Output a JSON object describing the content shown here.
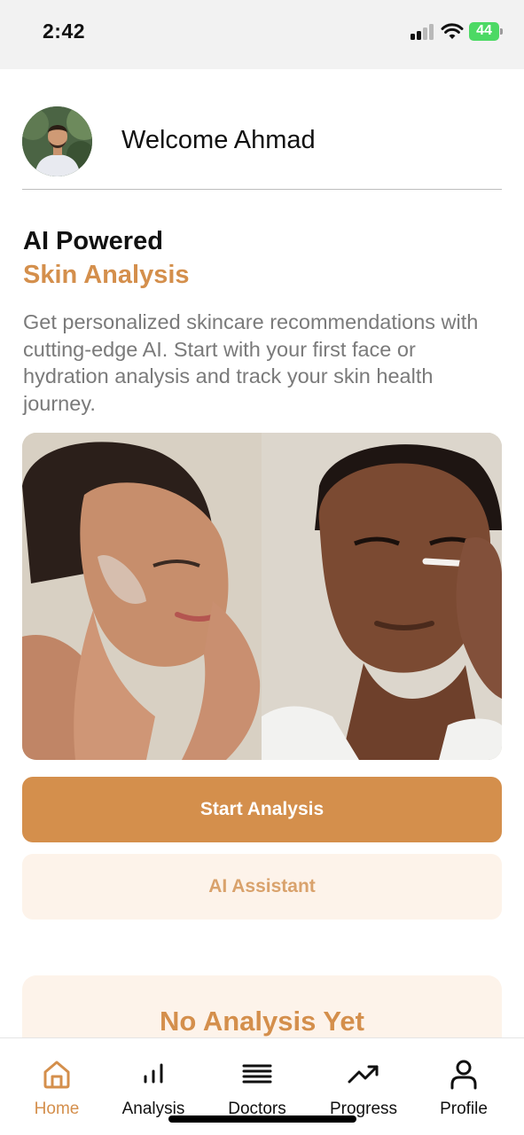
{
  "status_bar": {
    "time": "2:42",
    "battery": "44",
    "icons": [
      "signal-icon",
      "wifi-icon",
      "battery-icon"
    ]
  },
  "header": {
    "welcome": "Welcome Ahmad"
  },
  "hero": {
    "title": "AI Powered",
    "subtitle": "Skin Analysis",
    "description": "Get personalized skincare recommendations with cutting-edge AI. Start with your first face or hydration analysis and track your skin health journey."
  },
  "actions": {
    "primary": "Start Analysis",
    "secondary": "AI Assistant"
  },
  "empty_state": {
    "title": "No Analysis Yet"
  },
  "tabs": [
    {
      "label": "Home",
      "icon": "home-icon",
      "active": true
    },
    {
      "label": "Analysis",
      "icon": "bar-chart-icon",
      "active": false
    },
    {
      "label": "Doctors",
      "icon": "list-icon",
      "active": false
    },
    {
      "label": "Progress",
      "icon": "trending-up-icon",
      "active": false
    },
    {
      "label": "Profile",
      "icon": "user-icon",
      "active": false
    }
  ],
  "colors": {
    "accent": "#d48f4c",
    "accent_light": "#fdf3ea",
    "text_muted": "#7a7a7a"
  }
}
